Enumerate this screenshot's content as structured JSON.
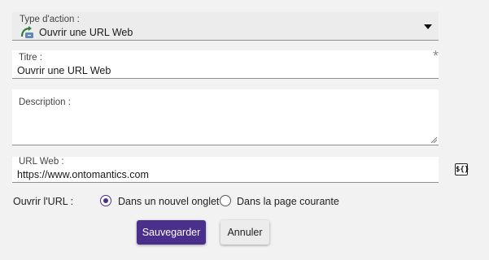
{
  "form": {
    "action_type": {
      "label": "Type d'action :",
      "value": "Ouvrir une URL Web",
      "icon": "open-url-icon"
    },
    "title": {
      "label": "Titre :",
      "value": "Ouvrir une URL Web",
      "required_mark": "*"
    },
    "description": {
      "label": "Description :",
      "value": ""
    },
    "url": {
      "label": "URL Web :",
      "value": "https://www.ontomantics.com",
      "variable_icon_text": "${}"
    },
    "open_in": {
      "label": "Ouvrir l'URL :",
      "options": [
        "Dans un nouvel onglet",
        "Dans la page courante"
      ],
      "selected": "Dans un nouvel onglet"
    }
  },
  "buttons": {
    "save": "Sauvegarder",
    "cancel": "Annuler"
  },
  "colors": {
    "primary": "#4a2f8c",
    "background": "#f2f2f2"
  }
}
